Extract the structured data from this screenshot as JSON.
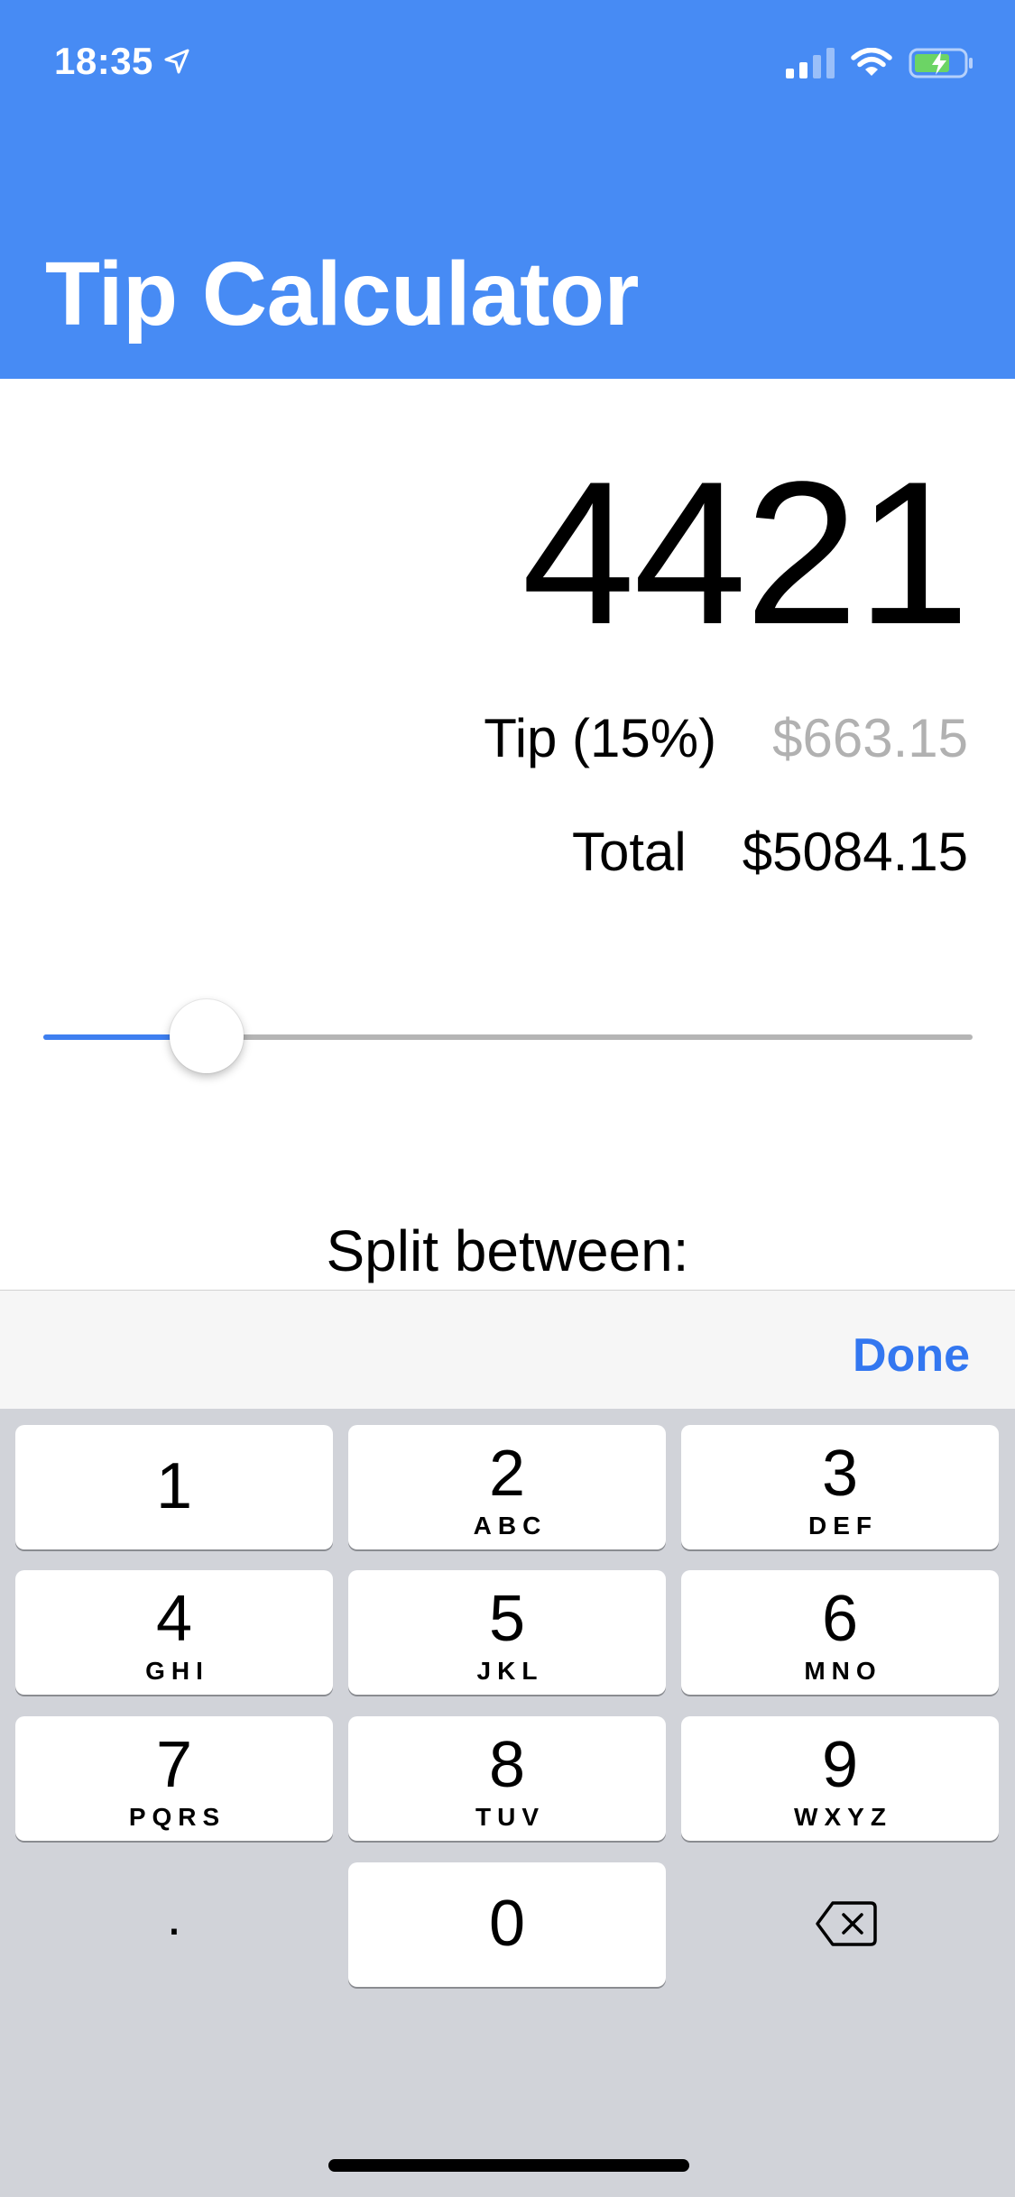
{
  "status_bar": {
    "time": "18:35",
    "icons": [
      "location-arrow-icon",
      "cellular-signal-icon",
      "wifi-icon",
      "battery-charging-icon"
    ]
  },
  "header": {
    "title": "Tip Calculator",
    "color": "#478bf4"
  },
  "bill_amount": "4421",
  "tip": {
    "label": "Tip (15%)",
    "value": "$663.15"
  },
  "total": {
    "label": "Total",
    "value": "$5084.15"
  },
  "tip_slider": {
    "level": 0.15,
    "accent": "#3e7ff0"
  },
  "split": {
    "label": "Split between:"
  },
  "accessory": {
    "done_label": "Done",
    "accent": "#3377f0"
  },
  "keypad": {
    "keys": [
      {
        "digit": "1",
        "letters": ""
      },
      {
        "digit": "2",
        "letters": "ABC"
      },
      {
        "digit": "3",
        "letters": "DEF"
      },
      {
        "digit": "4",
        "letters": "GHI"
      },
      {
        "digit": "5",
        "letters": "JKL"
      },
      {
        "digit": "6",
        "letters": "MNO"
      },
      {
        "digit": "7",
        "letters": "PQRS"
      },
      {
        "digit": "8",
        "letters": "TUV"
      },
      {
        "digit": "9",
        "letters": "WXYZ"
      },
      {
        "digit": "0",
        "letters": ""
      }
    ],
    "decimal": ".",
    "delete_icon": "backspace-icon"
  }
}
